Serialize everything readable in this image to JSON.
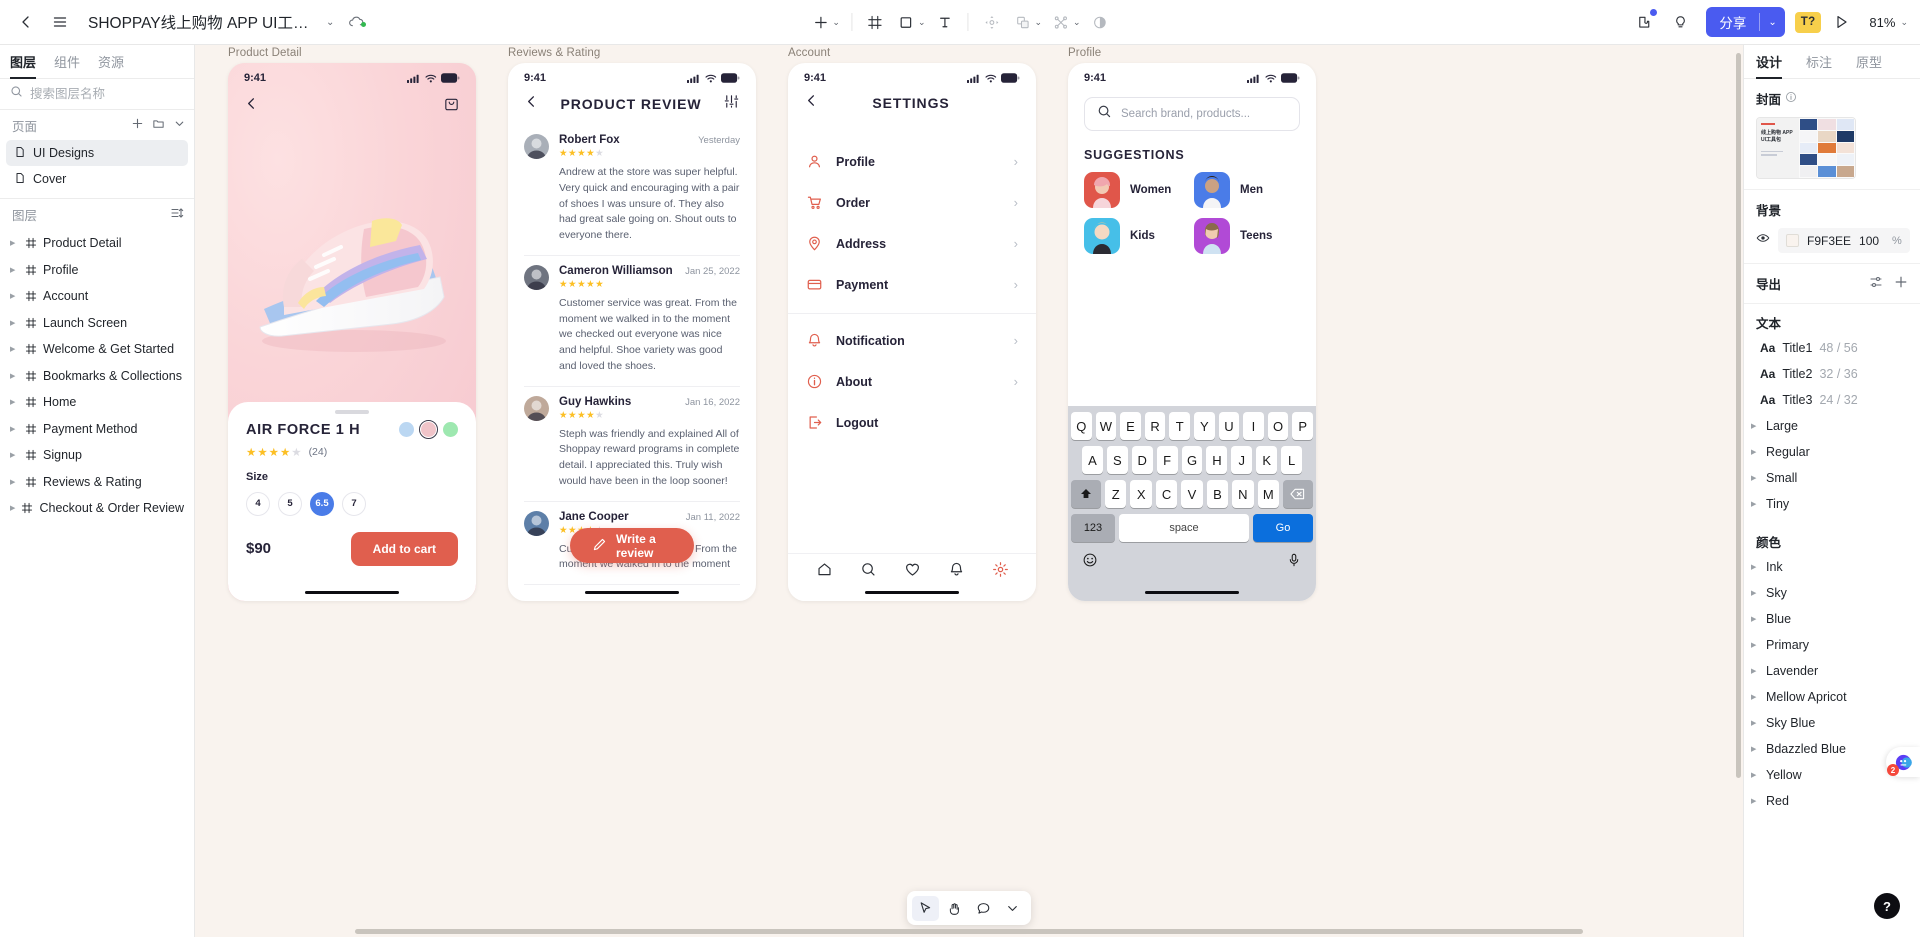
{
  "topbar": {
    "back_icon": "chevron-left-icon",
    "menu_icon": "hamburger-menu-icon",
    "file_title": "SHOPPAY线上购物 APP UI工具...",
    "title_caret": "⌄",
    "cloud_icon": "cloud-sync-icon",
    "tools": [
      {
        "name": "add-frame",
        "glyph": "+",
        "caret": true
      },
      {
        "name": "frame-tool",
        "glyph": "frame",
        "caret": false
      },
      {
        "name": "shape-tool",
        "glyph": "square",
        "caret": true
      },
      {
        "name": "text-tool",
        "glyph": "T",
        "caret": false
      },
      {
        "name": "move-tool",
        "glyph": "move",
        "caret": false
      },
      {
        "name": "boolean-tool",
        "glyph": "boolean",
        "caret": true
      },
      {
        "name": "mask-tool",
        "glyph": "mask",
        "caret": true
      },
      {
        "name": "contrast-tool",
        "glyph": "contrast",
        "caret": false
      }
    ],
    "plugin_icon": "plugin-icon",
    "idea_icon": "lightbulb-icon",
    "share_label": "分享",
    "share_caret": "⌄",
    "tq_label": "T?",
    "play_icon": "play-icon",
    "zoom_level": "81%",
    "zoom_caret": "⌄",
    "accent_color": "#4A5BF0",
    "badge_color": "#F7CF4B"
  },
  "left_panel": {
    "tabs": [
      {
        "label": "图层",
        "active": true
      },
      {
        "label": "组件",
        "active": false
      },
      {
        "label": "资源",
        "active": false
      }
    ],
    "search_placeholder": "搜索图层名称",
    "search_value": "",
    "filter_icon": "filter-icon",
    "pages_label": "页面",
    "pages_add_icon": "plus-icon",
    "pages_folder_icon": "folder-icon",
    "pages_collapse_icon": "chevron-down-icon",
    "pages": [
      {
        "label": "UI Designs",
        "selected": true
      },
      {
        "label": "Cover",
        "selected": false
      }
    ],
    "layers_label": "图层",
    "layers_sort_icon": "sort-icon",
    "layers": [
      "Product Detail",
      "Profile",
      "Account",
      "Launch Screen",
      "Welcome & Get Started",
      "Bookmarks & Collections",
      "Home",
      "Payment Method",
      "Signup",
      "Reviews & Rating",
      "Checkout & Order Review"
    ]
  },
  "canvas": {
    "background": "#F9F3EE",
    "artboards": [
      {
        "label": "Product Detail"
      },
      {
        "label": "Reviews & Rating"
      },
      {
        "label": "Account"
      },
      {
        "label": "Profile"
      }
    ],
    "product_detail": {
      "status_time": "9:41",
      "back_icon": "chevron-left-icon",
      "bag_icon": "shopping-bag-icon",
      "title": "AIR FORCE 1 H",
      "swatches": [
        {
          "name": "swatch-blue",
          "color": "#BBD7F2",
          "active": false
        },
        {
          "name": "swatch-pink",
          "color": "#F0C4C9",
          "active": true
        },
        {
          "name": "swatch-green",
          "color": "#9EE8B0",
          "active": false
        }
      ],
      "rating": 4,
      "rating_max": 5,
      "review_count": "(24)",
      "size_label": "Size",
      "sizes": [
        "4",
        "5",
        "6.5",
        "7"
      ],
      "size_selected": "6.5",
      "price": "$90",
      "cta_label": "Add to cart",
      "cta_color": "#E05F4E",
      "size_active_color": "#4A7CE8"
    },
    "reviews": {
      "status_time": "9:41",
      "back_icon": "chevron-left-icon",
      "title": "PRODUCT REVIEW",
      "filter_icon": "sliders-icon",
      "items": [
        {
          "name": "Robert Fox",
          "date": "Yesterday",
          "rating": 4,
          "text": "Andrew at the store was super helpful. Very quick and encouraging with a pair of shoes I was unsure of. They also had great sale going on. Shout outs to everyone there.",
          "avatar_color": "#A9AFB8"
        },
        {
          "name": "Cameron Williamson",
          "date": "Jan 25, 2022",
          "rating": 5,
          "text": "Customer service was great. From the moment we walked in to the moment we checked out everyone was nice and helpful. Shoe variety was good and loved the shoes.",
          "avatar_color": "#6F7480"
        },
        {
          "name": "Guy Hawkins",
          "date": "Jan 16, 2022",
          "rating": 4,
          "text": "Steph was friendly and explained All of Shoppay reward programs in complete detail. I appreciated this. Truly wish would have been in the loop sooner!",
          "avatar_color": "#BFA99A"
        },
        {
          "name": "Jane Cooper",
          "date": "Jan 11, 2022",
          "rating": 4,
          "text": "Customer service was great. From the moment we walked in to the moment",
          "avatar_color": "#5D7FA8"
        }
      ],
      "write_label": "Write a review",
      "write_icon": "pencil-icon",
      "write_color": "#E05F4E"
    },
    "account": {
      "status_time": "9:41",
      "back_icon": "chevron-left-icon",
      "title": "SETTINGS",
      "icon_color": "#E05F4E",
      "group_one": [
        {
          "label": "Profile",
          "icon": "user-icon"
        },
        {
          "label": "Order",
          "icon": "cart-icon"
        },
        {
          "label": "Address",
          "icon": "pin-icon"
        },
        {
          "label": "Payment",
          "icon": "card-icon"
        }
      ],
      "group_two": [
        {
          "label": "Notification",
          "icon": "bell-icon"
        },
        {
          "label": "About",
          "icon": "info-icon"
        },
        {
          "label": "Logout",
          "icon": "logout-icon"
        }
      ],
      "tabbar": [
        {
          "name": "home-icon",
          "active": false
        },
        {
          "name": "search-icon",
          "active": false
        },
        {
          "name": "heart-icon",
          "active": false
        },
        {
          "name": "bell-icon",
          "active": false
        },
        {
          "name": "gear-icon",
          "active": true
        }
      ]
    },
    "profile": {
      "status_time": "9:41",
      "search_icon": "search-icon",
      "search_placeholder": "Search brand, products...",
      "search_value": "",
      "suggestions_title": "SUGGESTIONS",
      "suggestions": [
        {
          "label": "Women",
          "color": "#E0564A"
        },
        {
          "label": "Men",
          "color": "#4A7CE8"
        },
        {
          "label": "Kids",
          "color": "#46BFE8"
        },
        {
          "label": "Teens",
          "color": "#B14AD6"
        }
      ],
      "keyboard": {
        "row1": [
          "Q",
          "W",
          "E",
          "R",
          "T",
          "Y",
          "U",
          "I",
          "O",
          "P"
        ],
        "row2": [
          "A",
          "S",
          "D",
          "F",
          "G",
          "H",
          "J",
          "K",
          "L"
        ],
        "row3": [
          "Z",
          "X",
          "C",
          "V",
          "B",
          "N",
          "M"
        ],
        "shift_icon": "shift-icon",
        "backspace_icon": "backspace-icon",
        "num_label": "123",
        "space_label": "space",
        "go_label": "Go",
        "go_color": "#0B6FDD",
        "emoji_icon": "emoji-icon",
        "mic_icon": "microphone-icon"
      }
    },
    "float_tools": [
      {
        "name": "cursor-tool",
        "active": true
      },
      {
        "name": "hand-tool",
        "active": false
      },
      {
        "name": "comment-tool",
        "active": false
      },
      {
        "name": "more-tools",
        "active": false
      }
    ]
  },
  "right_panel": {
    "tabs": [
      {
        "label": "设计",
        "active": true
      },
      {
        "label": "标注",
        "active": false
      },
      {
        "label": "原型",
        "active": false
      }
    ],
    "cover_label": "封面",
    "cover_info_icon": "info-icon",
    "cover_thumb_title": "线上购物 APP UI工具包",
    "background_label": "背景",
    "bg_eye_icon": "eye-icon",
    "bg_hex": "F9F3EE",
    "bg_opacity": "100",
    "bg_percent": "%",
    "export_label": "导出",
    "export_settings_icon": "sliders-icon",
    "export_add_icon": "plus-icon",
    "text_label": "文本",
    "text_styles": [
      {
        "name": "Title1",
        "size": "48 / 56"
      },
      {
        "name": "Title2",
        "size": "32 / 36"
      },
      {
        "name": "Title3",
        "size": "24 / 32"
      }
    ],
    "text_groups": [
      "Large",
      "Regular",
      "Small",
      "Tiny"
    ],
    "color_label": "颜色",
    "color_groups": [
      "Ink",
      "Sky",
      "Blue",
      "Primary",
      "Lavender",
      "Mellow Apricot",
      "Sky Blue",
      "Bdazzled Blue",
      "Yellow",
      "Red"
    ],
    "help_label": "?",
    "chat_badge": "2"
  }
}
